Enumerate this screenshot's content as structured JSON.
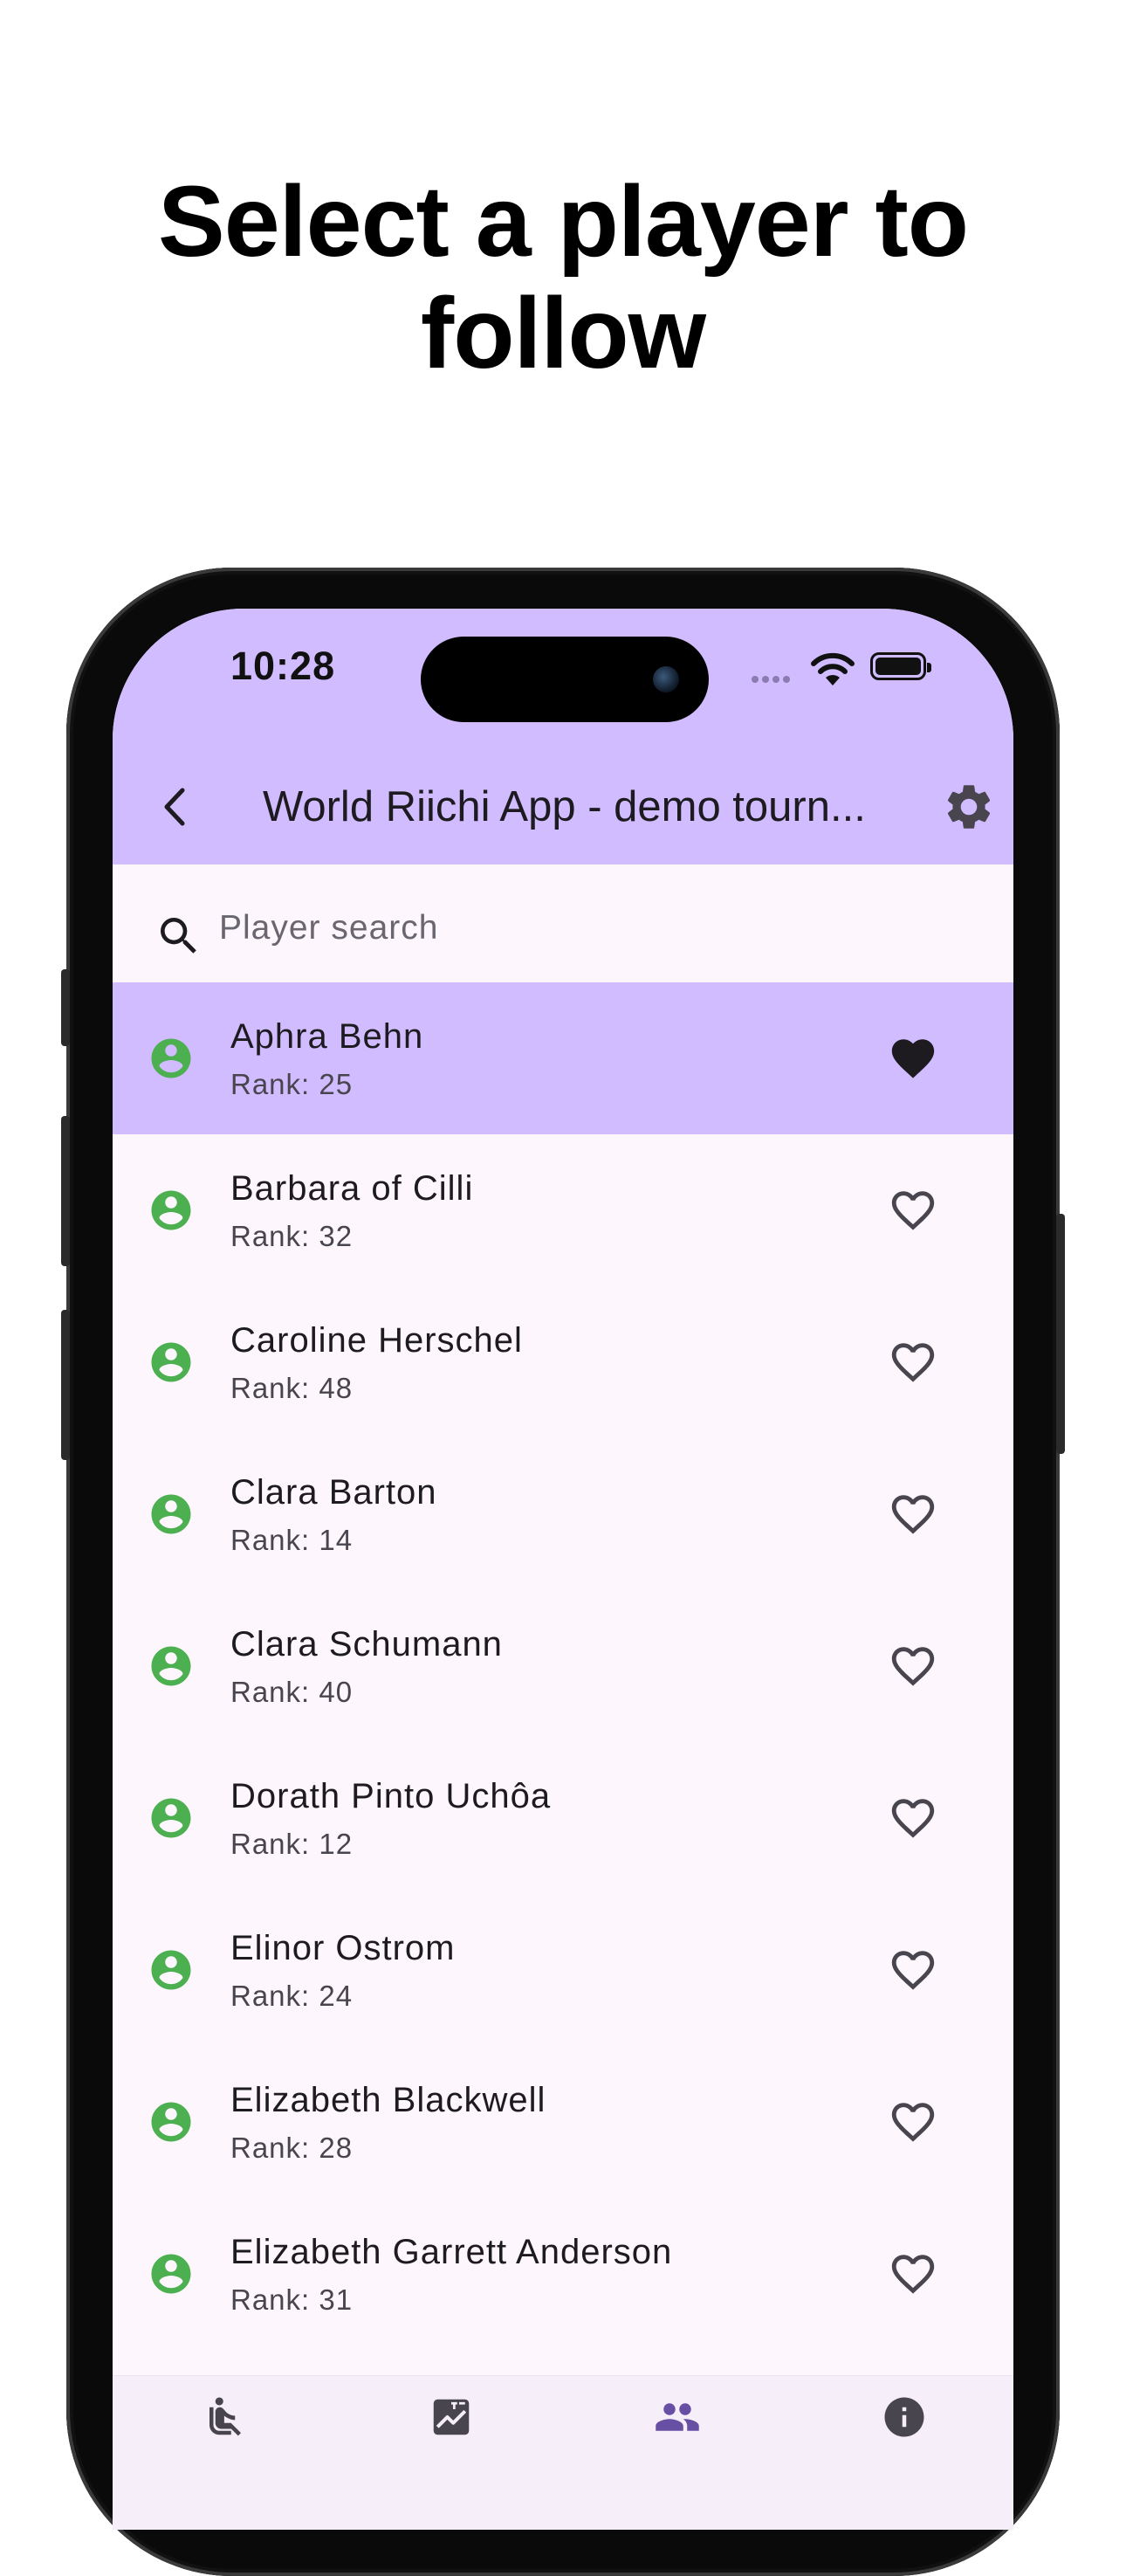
{
  "headline": {
    "line1": "Select a player to",
    "line2": "follow"
  },
  "status_bar": {
    "time": "10:28"
  },
  "app_bar": {
    "title": "World Riichi App - demo tourn..."
  },
  "search": {
    "placeholder": "Player search",
    "value": ""
  },
  "players": [
    {
      "name": "Aphra Behn",
      "rank": "Rank: 25",
      "followed": true
    },
    {
      "name": "Barbara of Cilli",
      "rank": "Rank: 32",
      "followed": false
    },
    {
      "name": "Caroline Herschel",
      "rank": "Rank: 48",
      "followed": false
    },
    {
      "name": "Clara Barton",
      "rank": "Rank: 14",
      "followed": false
    },
    {
      "name": "Clara Schumann",
      "rank": "Rank: 40",
      "followed": false
    },
    {
      "name": "Dorath Pinto Uchôa",
      "rank": "Rank: 12",
      "followed": false
    },
    {
      "name": "Elinor Ostrom",
      "rank": "Rank: 24",
      "followed": false
    },
    {
      "name": "Elizabeth Blackwell",
      "rank": "Rank: 28",
      "followed": false
    },
    {
      "name": "Elizabeth Garrett Anderson",
      "rank": "Rank: 31",
      "followed": false
    }
  ],
  "bottom_nav": [
    {
      "icon": "seat-icon",
      "active": false
    },
    {
      "icon": "ranking-chart-icon",
      "active": false
    },
    {
      "icon": "players-icon",
      "active": true
    },
    {
      "icon": "info-icon",
      "active": false
    }
  ],
  "colors": {
    "app_bar": "#d0bcff",
    "selected_row": "#d0bcff",
    "background": "#fdf7fd",
    "avatar": "#4caf50",
    "nav_active": "#6750a4",
    "nav_inactive": "#49454f"
  }
}
